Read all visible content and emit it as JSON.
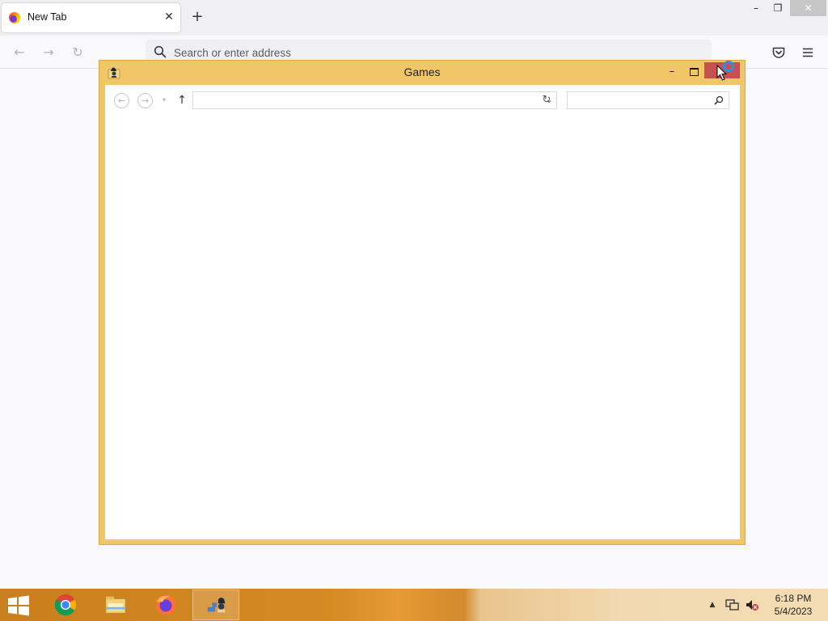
{
  "browser": {
    "tab": {
      "title": "New Tab",
      "close_glyph": "✕"
    },
    "new_tab_glyph": "+",
    "window_controls": {
      "minimize": "–",
      "maximize": "❐",
      "close": "✕"
    },
    "nav": {
      "back": "←",
      "forward": "→",
      "reload": "↻"
    },
    "urlbar": {
      "placeholder": "Search or enter address"
    },
    "icons": {
      "favicon": "firefox-icon",
      "search": "search-icon",
      "pocket": "pocket-icon",
      "menu": "hamburger-menu-icon"
    }
  },
  "explorer": {
    "title": "Games",
    "app_icon": "games-folder-icon",
    "controls": {
      "minimize": "–",
      "maximize": "maximize-icon",
      "close": "close-icon"
    },
    "toolbar": {
      "back": "←",
      "forward": "→",
      "recent": "▾",
      "up": "↑",
      "address_value": "",
      "address_dropdown": "⌄",
      "refresh": "↻",
      "search_value": ""
    }
  },
  "taskbar": {
    "start_icon": "windows-start-icon",
    "items": [
      {
        "name": "chrome",
        "icon": "chrome-icon"
      },
      {
        "name": "file-explorer",
        "icon": "file-explorer-icon"
      },
      {
        "name": "firefox",
        "icon": "firefox-icon"
      },
      {
        "name": "games",
        "icon": "games-icon"
      }
    ],
    "tray": {
      "show_hidden": "▲",
      "network_icon": "network-icon",
      "volume_icon": "volume-muted-icon"
    },
    "clock": {
      "time": "6:18 PM",
      "date": "5/4/2023"
    }
  },
  "colors": {
    "explorer_frame": "#f0c668",
    "close_red": "#c75050",
    "taskbar_orange": "#d58a22",
    "cursor_ring": "#2d8ee6"
  }
}
